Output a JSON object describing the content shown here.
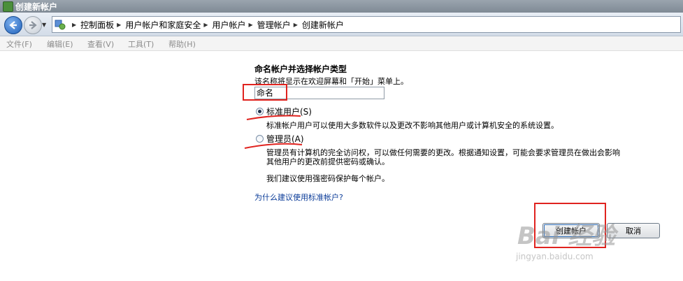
{
  "window": {
    "title": "创建新帐户"
  },
  "address": {
    "crumbs": [
      "控制面板",
      "用户帐户和家庭安全",
      "用户帐户",
      "管理帐户",
      "创建新帐户"
    ]
  },
  "menu": [
    "文件(F)",
    "编辑(E)",
    "查看(V)",
    "工具(T)",
    "帮助(H)"
  ],
  "form": {
    "heading": "命名帐户并选择帐户类型",
    "subtext": "该名称将显示在欢迎屏幕和「开始」菜单上。",
    "name_value": "命名",
    "standard_label": "标准用户(S)",
    "standard_desc": "标准帐户用户可以使用大多数软件以及更改不影响其他用户或计算机安全的系统设置。",
    "admin_label": "管理员(A)",
    "admin_desc_1": "管理员有计算机的完全访问权，可以做任何需要的更改。根据通知设置，可能会要求管理员在做出会影响",
    "admin_desc_2": "其他用户的更改前提供密码或确认。",
    "recommend": "我们建议使用强密码保护每个帐户。",
    "why_link": "为什么建议使用标准帐户?",
    "create_button": "创建帐户",
    "cancel_button": "取消"
  },
  "selected_account_type": "standard",
  "watermark": {
    "logo_text": "Bai 经验",
    "url": "jingyan.baidu.com"
  },
  "colors": {
    "annotation_red": "#e0231f",
    "link_blue": "#0a3b98"
  }
}
